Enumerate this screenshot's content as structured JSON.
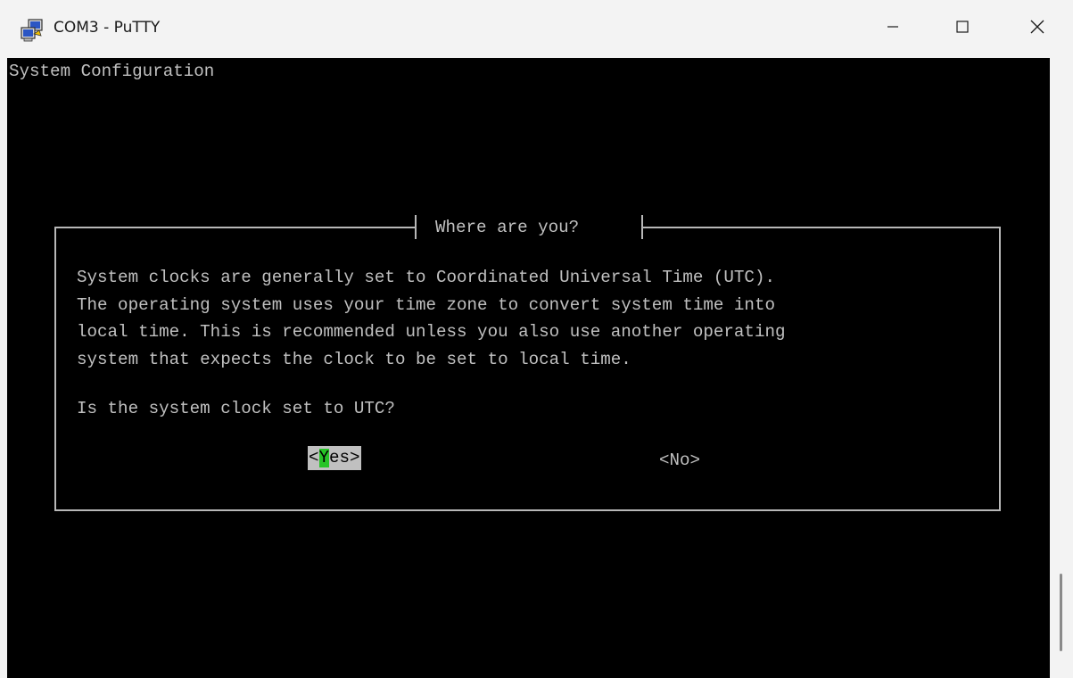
{
  "window": {
    "title": "COM3 - PuTTY",
    "icon": "putty-icon",
    "controls": [
      "minimize-icon",
      "maximize-icon",
      "close-icon"
    ]
  },
  "terminal": {
    "header": "System Configuration",
    "dialog": {
      "title": "Where are you?",
      "body_lines": [
        "System clocks are generally set to Coordinated Universal Time (UTC).",
        "The operating system uses your time zone to convert system time into",
        "local time. This is recommended unless you also use another operating",
        "system that expects the clock to be set to local time."
      ],
      "question": "Is the system clock set to UTC?",
      "buttons": {
        "yes_open": "<",
        "yes_hotkey": "Y",
        "yes_rest": "es>",
        "no": "<No>"
      },
      "selected_button": "yes"
    }
  },
  "colors": {
    "terminal_bg": "#000000",
    "terminal_fg": "#c0c0c0",
    "hotkey_highlight": "#27c427",
    "selected_bg": "#c0c0c0"
  }
}
